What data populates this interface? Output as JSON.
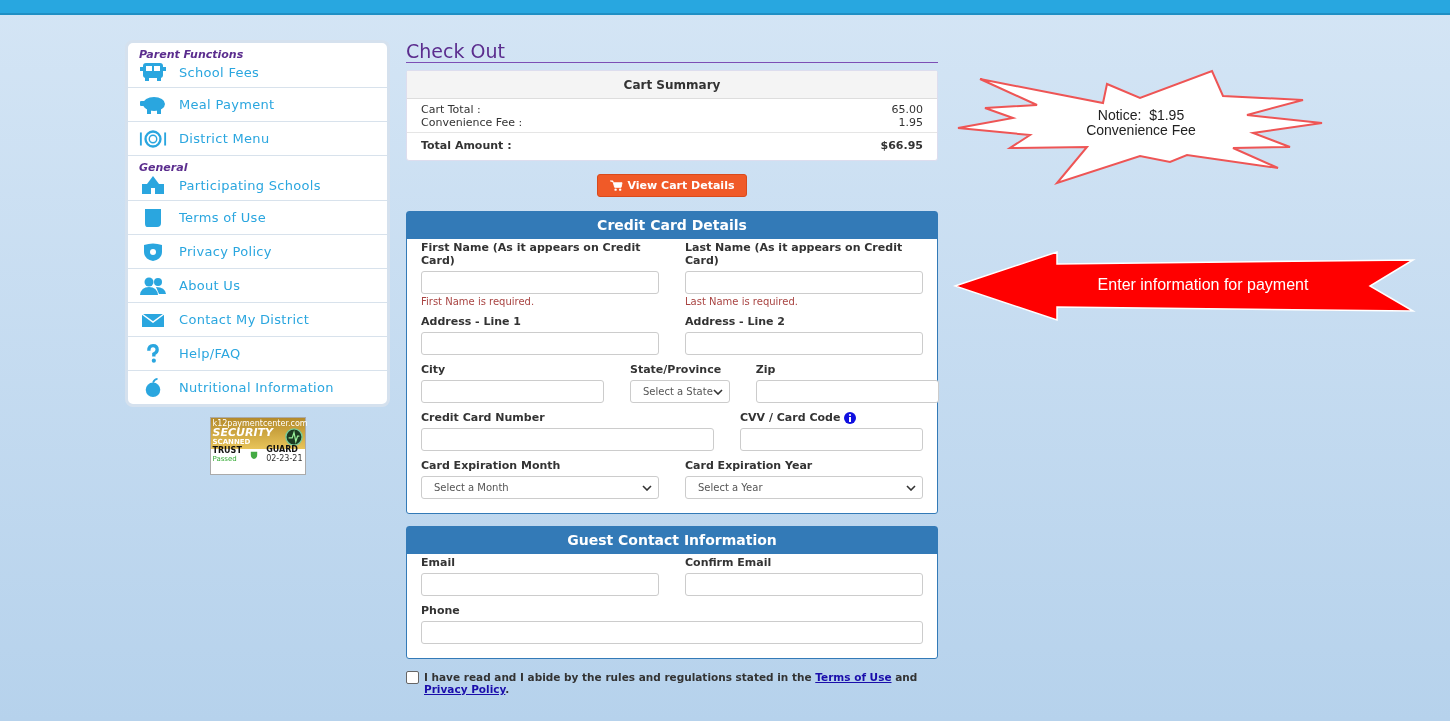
{
  "sidebar": {
    "sections": [
      {
        "heading": "Parent Functions",
        "items": [
          {
            "label": "School Fees"
          },
          {
            "label": "Meal Payment"
          },
          {
            "label": "District Menu"
          }
        ]
      },
      {
        "heading": "General",
        "items": [
          {
            "label": "Participating Schools"
          },
          {
            "label": "Terms of Use"
          },
          {
            "label": "Privacy Policy"
          },
          {
            "label": "About Us"
          },
          {
            "label": "Contact My District"
          },
          {
            "label": "Help/FAQ"
          },
          {
            "label": "Nutritional Information"
          }
        ]
      }
    ]
  },
  "security_seal": {
    "site": "k12paymentcenter.com",
    "title": "SECURITY",
    "subtitle": "SCANNED",
    "brand_left": "TRUST",
    "brand_right": "GUARD",
    "status": "Passed",
    "date": "02-23-21"
  },
  "page_title": "Check Out",
  "cart_summary": {
    "title": "Cart Summary",
    "rows": [
      {
        "label": "Cart Total :",
        "value": "65.00"
      },
      {
        "label": "Convenience Fee :",
        "value": "1.95"
      }
    ],
    "total": {
      "label": "Total Amount :",
      "value": "$66.95"
    }
  },
  "view_cart_button": "View Cart Details",
  "credit_card": {
    "title": "Credit Card Details",
    "rows": [
      {
        "kind": "halves",
        "fields": [
          {
            "label": "First Name (As it appears on Credit Card)",
            "kind": "input",
            "error": "First Name is required."
          },
          {
            "label": "Last Name (As it appears on Credit Card)",
            "kind": "input",
            "error": "Last Name is required."
          }
        ]
      },
      {
        "kind": "halves",
        "fields": [
          {
            "label": "Address - Line 1",
            "kind": "input"
          },
          {
            "label": "Address - Line 2",
            "kind": "input"
          }
        ]
      },
      {
        "kind": "thirds",
        "fields": [
          {
            "label": "City",
            "kind": "input"
          },
          {
            "label": "State/Province",
            "kind": "select",
            "placeholder": "Select a State"
          },
          {
            "label": "Zip",
            "kind": "input"
          }
        ]
      },
      {
        "kind": "wide-narrow",
        "fields": [
          {
            "label": "Credit Card Number",
            "kind": "input"
          },
          {
            "label": "CVV / Card Code",
            "kind": "input",
            "info_icon": true
          }
        ]
      },
      {
        "kind": "halves",
        "fields": [
          {
            "label": "Card Expiration Month",
            "kind": "select",
            "placeholder": "Select a Month"
          },
          {
            "label": "Card Expiration Year",
            "kind": "select",
            "placeholder": "Select a Year"
          }
        ]
      }
    ]
  },
  "guest_contact": {
    "title": "Guest Contact Information",
    "rows": [
      {
        "kind": "halves",
        "fields": [
          {
            "label": "Email",
            "kind": "input"
          },
          {
            "label": "Confirm Email",
            "kind": "input"
          }
        ]
      },
      {
        "kind": "full",
        "fields": [
          {
            "label": "Phone",
            "kind": "input"
          }
        ]
      }
    ]
  },
  "agreement": {
    "checked": false,
    "text": "I have read and I abide by the rules and regulations stated in the",
    "link_1": "Terms of Use",
    "joiner": "and",
    "link_2": "Privacy Policy",
    "end": "."
  },
  "callouts": [
    {
      "kind": "starburst",
      "lines": [
        "Notice:  $1.95",
        "Convenience Fee"
      ]
    },
    {
      "kind": "arrow",
      "lines": [
        "Enter information for payment"
      ]
    }
  ]
}
